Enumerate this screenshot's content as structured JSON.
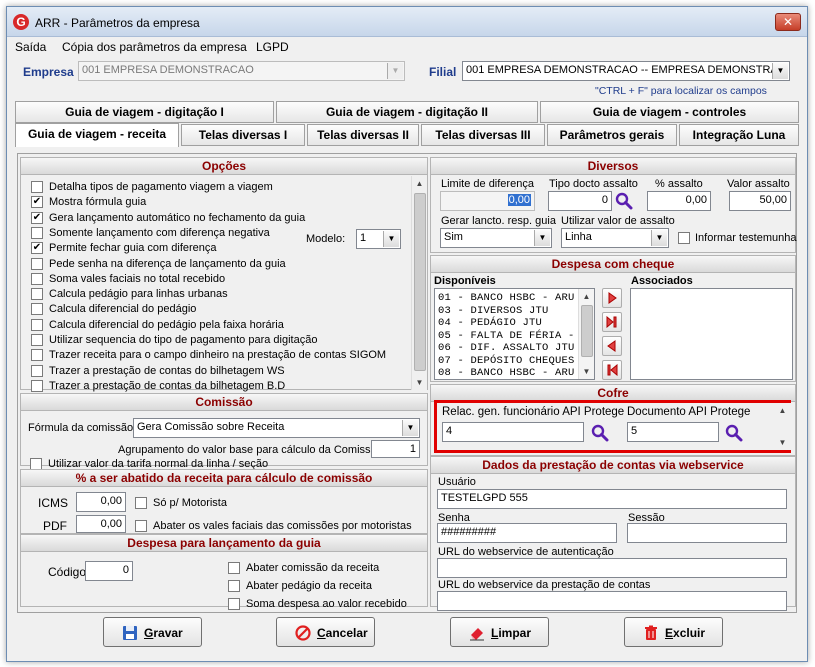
{
  "window": {
    "title": "ARR - Parâmetros da empresa",
    "close": "✕"
  },
  "menu": [
    "Saída",
    "Cópia dos parâmetros da empresa",
    "LGPD"
  ],
  "header": {
    "empresa_label": "Empresa",
    "empresa_value": "001 EMPRESA DEMONSTRACAO",
    "filial_label": "Filial",
    "filial_value": "001 EMPRESA DEMONSTRACAO -- EMPRESA DEMONSTRAC",
    "hint": "\"CTRL + F\" para localizar os campos"
  },
  "tabs_row1": [
    "Guia de viagem - digitação I",
    "Guia de viagem - digitação II",
    "Guia de viagem - controles"
  ],
  "tabs_row2": [
    "Guia de viagem - receita",
    "Telas diversas I",
    "Telas diversas II",
    "Telas diversas III",
    "Parâmetros gerais",
    "Integração Luna"
  ],
  "opcoes": {
    "title": "Opções",
    "items": [
      {
        "label": "Detalha tipos de pagamento viagem a viagem",
        "checked": false
      },
      {
        "label": "Mostra fórmula guia",
        "checked": true
      },
      {
        "label": "Gera lançamento automático no fechamento da guia",
        "checked": true
      },
      {
        "label": "Somente lançamento com diferença negativa",
        "checked": false
      },
      {
        "label": "Permite fechar guia com diferença",
        "checked": true
      },
      {
        "label": "Pede senha na diferença de lançamento da guia",
        "checked": false
      },
      {
        "label": "Soma vales faciais no total recebido",
        "checked": false
      },
      {
        "label": "Calcula pedágio para linhas urbanas",
        "checked": false
      },
      {
        "label": "Calcula diferencial do pedágio",
        "checked": false
      },
      {
        "label": "Calcula diferencial do pedágio pela faixa horária",
        "checked": false
      },
      {
        "label": "Utilizar sequencia do tipo de pagamento para digitação",
        "checked": false
      },
      {
        "label": "Trazer receita para o campo dinheiro na prestação de contas SIGOM",
        "checked": false
      },
      {
        "label": "Trazer a prestação de contas do bilhetagem WS",
        "checked": false
      },
      {
        "label": "Trazer a prestação de contas da bilhetagem B.D",
        "checked": false
      }
    ],
    "modelo_label": "Modelo:",
    "modelo_value": "1"
  },
  "comissao": {
    "title": "Comissão",
    "formula_label": "Fórmula da comissão",
    "formula_value": "Gera Comissão sobre  Receita",
    "agrup_label": "Agrupamento do valor base para cálculo da Comissão",
    "agrup_value": "1",
    "tarifa_label": "Utilizar valor da tarifa normal da linha / seção"
  },
  "abatido": {
    "title": "% a ser abatido da receita para cálculo de comissão",
    "icms_label": "ICMS",
    "icms_value": "0,00",
    "so_motorista": "Só p/ Motorista",
    "pdf_label": "PDF",
    "pdf_value": "0,00",
    "abater_vales": "Abater os vales faciais das comissões por motoristas"
  },
  "despesa_lanc": {
    "title": "Despesa para lançamento da guia",
    "codigo_label": "Código",
    "codigo_value": "0",
    "opt1": "Abater comissão da receita",
    "opt2": "Abater pedágio da receita",
    "opt3": "Soma despesa ao valor recebido"
  },
  "diversos": {
    "title": "Diversos",
    "limite_label": "Limite de diferença",
    "limite_value": "0,00",
    "tipo_label": "Tipo docto assalto",
    "tipo_value": "0",
    "pct_label": "% assalto",
    "pct_value": "0,00",
    "valor_label": "Valor assalto",
    "valor_value": "50,00",
    "gerar_label": "Gerar lancto. resp. guia",
    "gerar_value": "Sim",
    "utilizar_label": "Utilizar valor de assalto",
    "utilizar_value": "Linha",
    "informar_label": "Informar testemunha"
  },
  "cheque": {
    "title": "Despesa com cheque",
    "disp_label": "Disponíveis",
    "assoc_label": "Associados",
    "items": [
      "01 - BANCO HSBC - ARU",
      "03 - DIVERSOS JTU",
      "04 - PEDÁGIO JTU",
      "05 - FALTA DE FÉRIA -",
      "06 - DIF. ASSALTO JTU",
      "07 - DEPÓSITO CHEQUES",
      "08 - BANCO HSBC - ARU"
    ]
  },
  "cofre": {
    "title": "Cofre",
    "relac_label": "Relac. gen. funcionário API Protege",
    "relac_value": "4",
    "doc_label": "Documento API Protege",
    "doc_value": "5"
  },
  "webservice": {
    "title": "Dados da prestação de contas via webservice",
    "usuario_label": "Usuário",
    "usuario_value": "TESTELGPD 555",
    "senha_label": "Senha",
    "senha_value": "#########",
    "sessao_label": "Sessão",
    "sessao_value": "",
    "url_auth_label": "URL do webservice de autenticação",
    "url_auth_value": "",
    "url_prest_label": "URL do webservice da prestação de contas",
    "url_prest_value": ""
  },
  "buttons": {
    "gravar_u": "G",
    "gravar_r": "ravar",
    "cancelar_u": "C",
    "cancelar_r": "ancelar",
    "limpar_u": "L",
    "limpar_r": "impar",
    "excluir_u": "E",
    "excluir_r": "xcluir"
  },
  "colors": {
    "group_title": "#8b0000",
    "highlight": "#e00000",
    "magnifier": "#5a1fb0"
  }
}
